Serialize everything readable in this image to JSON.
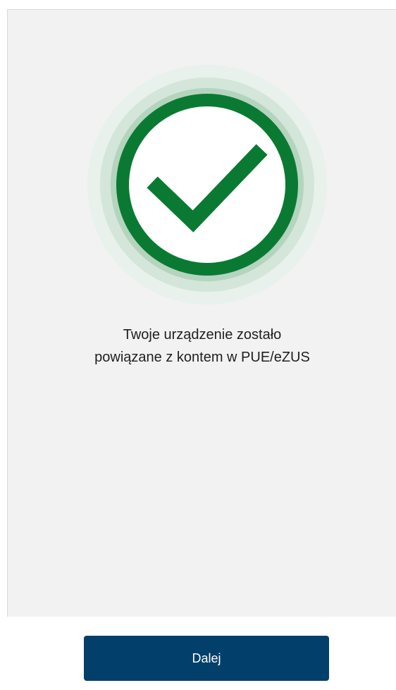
{
  "colors": {
    "screen_background": "#f2f2f2",
    "success_green": "#0a7a32",
    "halo_light": "#e3eee7",
    "halo_mid": "#c9e0d0",
    "halo_dark": "#a9cdb5",
    "primary_button": "#023f6b",
    "text": "#1f1f1f"
  },
  "success": {
    "icon": "check-circle-icon",
    "message_line1": "Twoje urządzenie zostało",
    "message_line2": "powiązane z kontem w PUE/eZUS"
  },
  "footer": {
    "next_label": "Dalej"
  }
}
